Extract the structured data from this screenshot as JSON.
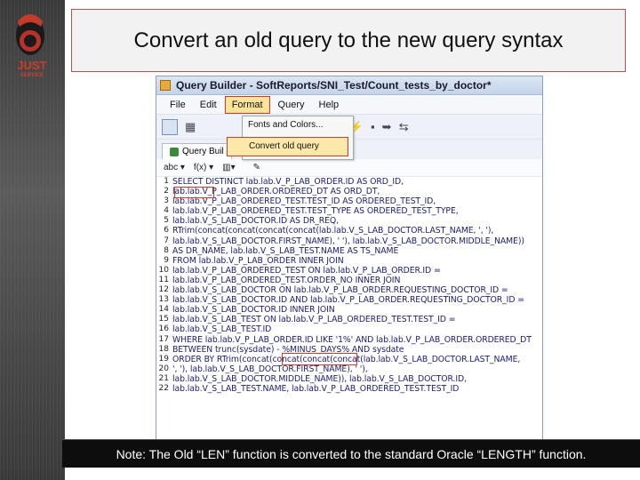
{
  "slide": {
    "title": "Convert an old query to the new query syntax",
    "note": "Note: The Old “LEN” function is converted to the standard Oracle “LENGTH” function.",
    "logo_text": "JUST",
    "logo_sub": "SERVICE"
  },
  "window": {
    "title": "Query Builder - SoftReports/SNI_Test/Count_tests_by_doctor*",
    "menu": [
      "File",
      "Edit",
      "Format",
      "Query",
      "Help"
    ],
    "active_menu": "Format",
    "dropdown": [
      "Fonts and Colors...",
      "Convert old query"
    ],
    "tab": "Query Buil",
    "editor_tools": [
      "abc ▾",
      "f(x) ▾",
      "▾"
    ],
    "accent": "#d03a2a"
  },
  "code_lines": [
    {
      "n": "1",
      "text": "SELECT DISTINCT lab.lab.V_P_LAB_ORDER.ID AS ORD_ID,"
    },
    {
      "n": "2",
      "text": "lab.lab.V_P_LAB_ORDER.ORDERED_DT AS ORD_DT,"
    },
    {
      "n": "3",
      "text": "lab.lab.V_P_LAB_ORDERED_TEST.TEST_ID AS ORDERED_TEST_ID,"
    },
    {
      "n": "4",
      "text": "lab.lab.V_P_LAB_ORDERED_TEST.TEST_TYPE AS ORDERED_TEST_TYPE,"
    },
    {
      "n": "5",
      "text": "lab.lab.V_S_LAB_DOCTOR.ID AS DR_REQ,"
    },
    {
      "n": "6",
      "text": "RTrim(concat(concat(concat(concat(lab.lab.V_S_LAB_DOCTOR.LAST_NAME, ', '),"
    },
    {
      "n": "7",
      "text": "lab.lab.V_S_LAB_DOCTOR.FIRST_NAME), ' '), lab.lab.V_S_LAB_DOCTOR.MIDDLE_NAME))"
    },
    {
      "n": "8",
      "text": "AS DR_NAME, lab.lab.V_S_LAB_TEST.NAME AS TS_NAME"
    },
    {
      "n": "9",
      "text": "FROM lab.lab.V_P_LAB_ORDER INNER JOIN"
    },
    {
      "n": "10",
      "text": "lab.lab.V_P_LAB_ORDERED_TEST ON lab.lab.V_P_LAB_ORDER.ID ="
    },
    {
      "n": "11",
      "text": "lab.lab.V_P_LAB_ORDERED_TEST.ORDER_NO INNER JOIN"
    },
    {
      "n": "12",
      "text": "lab.lab.V_S_LAB_DOCTOR ON lab.lab.V_P_LAB_ORDER.REQUESTING_DOCTOR_ID ="
    },
    {
      "n": "13",
      "text": "lab.lab.V_S_LAB_DOCTOR.ID AND lab.lab.V_P_LAB_ORDER.REQUESTING_DOCTOR_ID ="
    },
    {
      "n": "14",
      "text": "lab.lab.V_S_LAB_DOCTOR.ID INNER JOIN"
    },
    {
      "n": "15",
      "text": "lab.lab.V_S_LAB_TEST ON lab.lab.V_P_LAB_ORDERED_TEST.TEST_ID ="
    },
    {
      "n": "16",
      "text": "lab.lab.V_S_LAB_TEST.ID"
    },
    {
      "n": "17",
      "text": "WHERE lab.lab.V_P_LAB_ORDER.ID LIKE '1%' AND lab.lab.V_P_LAB_ORDER.ORDERED_DT"
    },
    {
      "n": "18",
      "text": "BETWEEN trunc(sysdate) - %MINUS_DAYS% AND sysdate"
    },
    {
      "n": "19",
      "text": "ORDER BY RTrim(concat(concat(concat(concat(lab.lab.V_S_LAB_DOCTOR.LAST_NAME,"
    },
    {
      "n": "20",
      "text": "', '), lab.lab.V_S_LAB_DOCTOR.FIRST_NAME), ' '),"
    },
    {
      "n": "21",
      "text": "lab.lab.V_S_LAB_DOCTOR.MIDDLE_NAME)), lab.lab.V_S_LAB_DOCTOR.ID,"
    },
    {
      "n": "22",
      "text": "lab.lab.V_S_LAB_TEST.NAME, lab.lab.V_P_LAB_ORDERED_TEST.TEST_ID"
    }
  ]
}
